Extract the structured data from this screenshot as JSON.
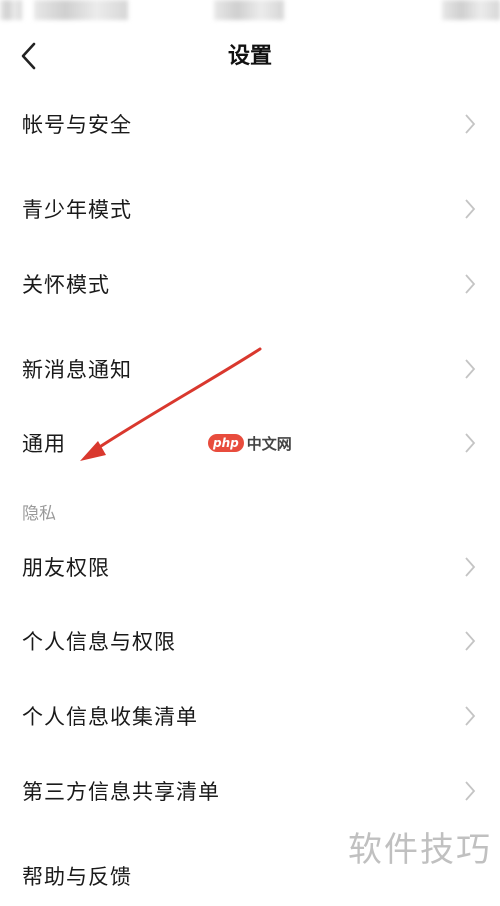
{
  "header": {
    "title": "设置"
  },
  "rows": [
    {
      "label": "帐号与安全"
    },
    {
      "label": "青少年模式"
    },
    {
      "label": "关怀模式"
    },
    {
      "label": "新消息通知"
    },
    {
      "label": "通用"
    },
    {
      "label": "朋友权限"
    },
    {
      "label": "个人信息与权限"
    },
    {
      "label": "个人信息收集清单"
    },
    {
      "label": "第三方信息共享清单"
    },
    {
      "label": "帮助与反馈"
    }
  ],
  "sections": {
    "privacy": "隐私"
  },
  "watermarks": {
    "php_badge": "php",
    "php_text": "中文网",
    "corner": "软件技巧"
  },
  "colors": {
    "annotation_arrow": "#d9382e",
    "chevron": "#c4c4c4",
    "section_header": "#9a9a9a"
  },
  "icons": {
    "back": "chevron-left-icon",
    "row_chevron": "chevron-right-icon"
  }
}
